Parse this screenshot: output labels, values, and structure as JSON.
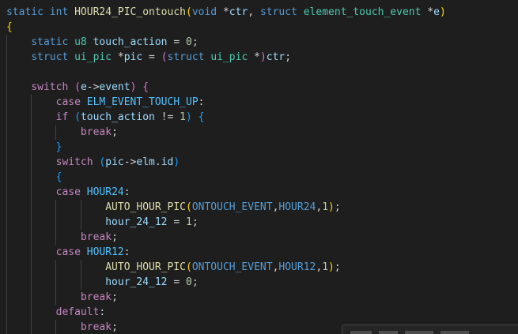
{
  "editor": {
    "colors": {
      "background": "#1e1e1e",
      "keyword": "#569cd6",
      "control": "#c586c0",
      "function": "#dcdcaa",
      "variable": "#9cdcfe",
      "type": "#4ec9b0",
      "number": "#b5cea8",
      "text": "#d4d4d4",
      "bracket_level_1": "#ffd700",
      "bracket_level_2": "#da70d6",
      "bracket_level_3": "#179fff",
      "constant": "#4fc1ff"
    },
    "lines": [
      {
        "guides": 0,
        "tokens": [
          {
            "t": "static",
            "c": "kw"
          },
          {
            "t": " ",
            "c": "plain"
          },
          {
            "t": "int",
            "c": "kw"
          },
          {
            "t": " ",
            "c": "plain"
          },
          {
            "t": "HOUR24_PIC_ontouch",
            "c": "fn"
          },
          {
            "t": "(",
            "c": "b1"
          },
          {
            "t": "void",
            "c": "kw"
          },
          {
            "t": " *",
            "c": "plain"
          },
          {
            "t": "ctr",
            "c": "var"
          },
          {
            "t": ", ",
            "c": "plain"
          },
          {
            "t": "struct",
            "c": "kw"
          },
          {
            "t": " ",
            "c": "plain"
          },
          {
            "t": "element_touch_event",
            "c": "type"
          },
          {
            "t": " *",
            "c": "plain"
          },
          {
            "t": "e",
            "c": "var"
          },
          {
            "t": ")",
            "c": "b1"
          }
        ]
      },
      {
        "guides": 0,
        "tokens": [
          {
            "t": "{",
            "c": "b1"
          }
        ]
      },
      {
        "guides": 1,
        "tokens": [
          {
            "t": "    ",
            "c": "plain"
          },
          {
            "t": "static",
            "c": "kw"
          },
          {
            "t": " ",
            "c": "plain"
          },
          {
            "t": "u8",
            "c": "type"
          },
          {
            "t": " ",
            "c": "plain"
          },
          {
            "t": "touch_action",
            "c": "var"
          },
          {
            "t": " = ",
            "c": "plain"
          },
          {
            "t": "0",
            "c": "num"
          },
          {
            "t": ";",
            "c": "plain"
          }
        ]
      },
      {
        "guides": 1,
        "tokens": [
          {
            "t": "    ",
            "c": "plain"
          },
          {
            "t": "struct",
            "c": "kw"
          },
          {
            "t": " ",
            "c": "plain"
          },
          {
            "t": "ui_pic",
            "c": "type"
          },
          {
            "t": " *",
            "c": "plain"
          },
          {
            "t": "pic",
            "c": "var"
          },
          {
            "t": " = ",
            "c": "plain"
          },
          {
            "t": "(",
            "c": "b2"
          },
          {
            "t": "struct",
            "c": "kw"
          },
          {
            "t": " ",
            "c": "plain"
          },
          {
            "t": "ui_pic",
            "c": "type"
          },
          {
            "t": " *",
            "c": "plain"
          },
          {
            "t": ")",
            "c": "b2"
          },
          {
            "t": "ctr",
            "c": "var"
          },
          {
            "t": ";",
            "c": "plain"
          }
        ]
      },
      {
        "guides": 1,
        "tokens": []
      },
      {
        "guides": 1,
        "tokens": [
          {
            "t": "    ",
            "c": "plain"
          },
          {
            "t": "switch",
            "c": "ctl"
          },
          {
            "t": " ",
            "c": "plain"
          },
          {
            "t": "(",
            "c": "b2"
          },
          {
            "t": "e",
            "c": "var"
          },
          {
            "t": "->",
            "c": "plain"
          },
          {
            "t": "event",
            "c": "var"
          },
          {
            "t": ")",
            "c": "b2"
          },
          {
            "t": " ",
            "c": "plain"
          },
          {
            "t": "{",
            "c": "b2"
          }
        ]
      },
      {
        "guides": 2,
        "tokens": [
          {
            "t": "        ",
            "c": "plain"
          },
          {
            "t": "case",
            "c": "ctl"
          },
          {
            "t": " ",
            "c": "plain"
          },
          {
            "t": "ELM_EVENT_TOUCH_UP",
            "c": "cst"
          },
          {
            "t": ":",
            "c": "plain"
          }
        ]
      },
      {
        "guides": 2,
        "tokens": [
          {
            "t": "        ",
            "c": "plain"
          },
          {
            "t": "if",
            "c": "ctl"
          },
          {
            "t": " ",
            "c": "plain"
          },
          {
            "t": "(",
            "c": "b3"
          },
          {
            "t": "touch_action",
            "c": "var"
          },
          {
            "t": " != ",
            "c": "plain"
          },
          {
            "t": "1",
            "c": "num"
          },
          {
            "t": ")",
            "c": "b3"
          },
          {
            "t": " ",
            "c": "plain"
          },
          {
            "t": "{",
            "c": "b3"
          }
        ]
      },
      {
        "guides": 3,
        "tokens": [
          {
            "t": "            ",
            "c": "plain"
          },
          {
            "t": "break",
            "c": "ctl"
          },
          {
            "t": ";",
            "c": "plain"
          }
        ]
      },
      {
        "guides": 2,
        "tokens": [
          {
            "t": "        ",
            "c": "plain"
          },
          {
            "t": "}",
            "c": "b3"
          }
        ]
      },
      {
        "guides": 2,
        "tokens": [
          {
            "t": "        ",
            "c": "plain"
          },
          {
            "t": "switch",
            "c": "ctl"
          },
          {
            "t": " ",
            "c": "plain"
          },
          {
            "t": "(",
            "c": "b3"
          },
          {
            "t": "pic",
            "c": "var"
          },
          {
            "t": "->",
            "c": "plain"
          },
          {
            "t": "elm",
            "c": "var"
          },
          {
            "t": ".",
            "c": "plain"
          },
          {
            "t": "id",
            "c": "var"
          },
          {
            "t": ")",
            "c": "b3"
          }
        ]
      },
      {
        "guides": 2,
        "tokens": [
          {
            "t": "        ",
            "c": "plain"
          },
          {
            "t": "{",
            "c": "b3"
          }
        ]
      },
      {
        "guides": 2,
        "tokens": [
          {
            "t": "        ",
            "c": "plain"
          },
          {
            "t": "case",
            "c": "ctl"
          },
          {
            "t": " ",
            "c": "plain"
          },
          {
            "t": "HOUR24",
            "c": "cst"
          },
          {
            "t": ":",
            "c": "plain"
          }
        ]
      },
      {
        "guides": 4,
        "tokens": [
          {
            "t": "                ",
            "c": "plain"
          },
          {
            "t": "AUTO_HOUR_PIC",
            "c": "mac"
          },
          {
            "t": "(",
            "c": "b1"
          },
          {
            "t": "ONTOUCH_EVENT",
            "c": "kw"
          },
          {
            "t": ",",
            "c": "plain"
          },
          {
            "t": "HOUR24",
            "c": "kw"
          },
          {
            "t": ",",
            "c": "plain"
          },
          {
            "t": "1",
            "c": "num"
          },
          {
            "t": ")",
            "c": "b1"
          },
          {
            "t": ";",
            "c": "plain"
          }
        ]
      },
      {
        "guides": 4,
        "tokens": [
          {
            "t": "                ",
            "c": "plain"
          },
          {
            "t": "hour_24_12",
            "c": "var"
          },
          {
            "t": " = ",
            "c": "plain"
          },
          {
            "t": "1",
            "c": "num"
          },
          {
            "t": ";",
            "c": "plain"
          }
        ]
      },
      {
        "guides": 3,
        "tokens": [
          {
            "t": "            ",
            "c": "plain"
          },
          {
            "t": "break",
            "c": "ctl"
          },
          {
            "t": ";",
            "c": "plain"
          }
        ]
      },
      {
        "guides": 2,
        "tokens": [
          {
            "t": "        ",
            "c": "plain"
          },
          {
            "t": "case",
            "c": "ctl"
          },
          {
            "t": " ",
            "c": "plain"
          },
          {
            "t": "HOUR12",
            "c": "cst"
          },
          {
            "t": ":",
            "c": "plain"
          }
        ]
      },
      {
        "guides": 4,
        "tokens": [
          {
            "t": "                ",
            "c": "plain"
          },
          {
            "t": "AUTO_HOUR_PIC",
            "c": "mac"
          },
          {
            "t": "(",
            "c": "b1"
          },
          {
            "t": "ONTOUCH_EVENT",
            "c": "kw"
          },
          {
            "t": ",",
            "c": "plain"
          },
          {
            "t": "HOUR12",
            "c": "kw"
          },
          {
            "t": ",",
            "c": "plain"
          },
          {
            "t": "1",
            "c": "num"
          },
          {
            "t": ")",
            "c": "b1"
          },
          {
            "t": ";",
            "c": "plain"
          }
        ]
      },
      {
        "guides": 4,
        "tokens": [
          {
            "t": "                ",
            "c": "plain"
          },
          {
            "t": "hour_24_12",
            "c": "var"
          },
          {
            "t": " = ",
            "c": "plain"
          },
          {
            "t": "0",
            "c": "num"
          },
          {
            "t": ";",
            "c": "plain"
          }
        ]
      },
      {
        "guides": 3,
        "tokens": [
          {
            "t": "            ",
            "c": "plain"
          },
          {
            "t": "break",
            "c": "ctl"
          },
          {
            "t": ";",
            "c": "plain"
          }
        ]
      },
      {
        "guides": 2,
        "tokens": [
          {
            "t": "        ",
            "c": "plain"
          },
          {
            "t": "default",
            "c": "ctl"
          },
          {
            "t": ":",
            "c": "plain"
          }
        ]
      },
      {
        "guides": 3,
        "tokens": [
          {
            "t": "            ",
            "c": "plain"
          },
          {
            "t": "break",
            "c": "ctl"
          },
          {
            "t": ";",
            "c": "plain"
          }
        ]
      }
    ]
  }
}
